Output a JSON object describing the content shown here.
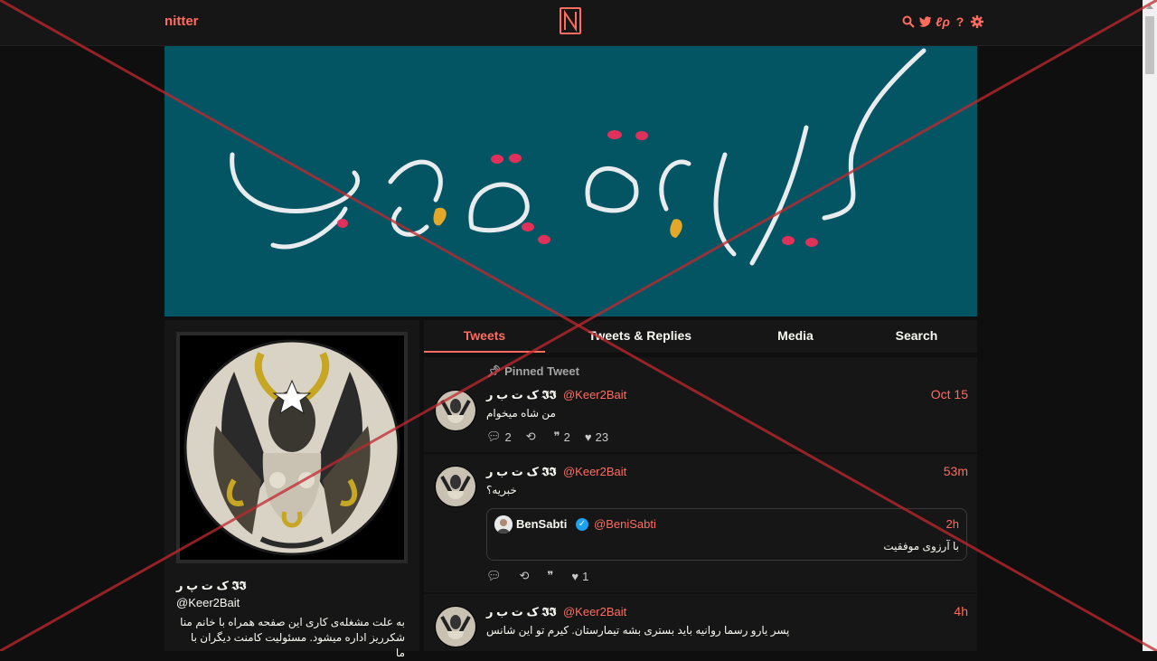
{
  "nav": {
    "brand": "nitter",
    "logo_letter": "N",
    "icons": [
      "search-icon",
      "twitter-icon",
      "rss-icon",
      "help-icon",
      "gear-icon"
    ]
  },
  "banner": {
    "text": "کیرم تو بیت رهبری",
    "background": "#045563"
  },
  "profile": {
    "fullname": "ک ت پ ر 𝕴𝕴",
    "username": "@Keer2Bait",
    "bio": "به علت مشغله‌ی کاری این صفحه همراه با خانم منا شکرریز اداره میشود. مسئولیت کامنت دیگران با ما"
  },
  "tabs": [
    {
      "label": "Tweets",
      "active": true
    },
    {
      "label": "Tweets & Replies",
      "active": false
    },
    {
      "label": "Media",
      "active": false
    },
    {
      "label": "Search",
      "active": false
    }
  ],
  "timeline": [
    {
      "pinned_label": "Pinned Tweet",
      "fullname": "ک ت ب ر 𝕴𝕴",
      "username": "@Keer2Bait",
      "date": "Oct 15",
      "text": "من شاه میخوام",
      "stats": {
        "replies": "2",
        "retweets": "",
        "quotes": "2",
        "likes": "23"
      }
    },
    {
      "fullname": "ک ت ب ر 𝕴𝕴",
      "username": "@Keer2Bait",
      "date": "53m",
      "text": "خبریه؟",
      "quote": {
        "fullname": "BenSabti",
        "username": "@BeniSabti",
        "date": "2h",
        "text": "با آرزوی موفقیت"
      },
      "stats": {
        "replies": "",
        "retweets": "",
        "quotes": "",
        "likes": "1"
      }
    },
    {
      "fullname": "ک ت ب ر 𝕴𝕴",
      "username": "@Keer2Bait",
      "date": "4h",
      "text": "پسر یارو رسما روانیه باید بستری بشه تیمارستان. کیرم تو این شانس"
    }
  ],
  "colors": {
    "accent": "#ff6c60",
    "background": "#0f0f0f",
    "panel": "#161616",
    "overlay_x": "#c0282e"
  }
}
